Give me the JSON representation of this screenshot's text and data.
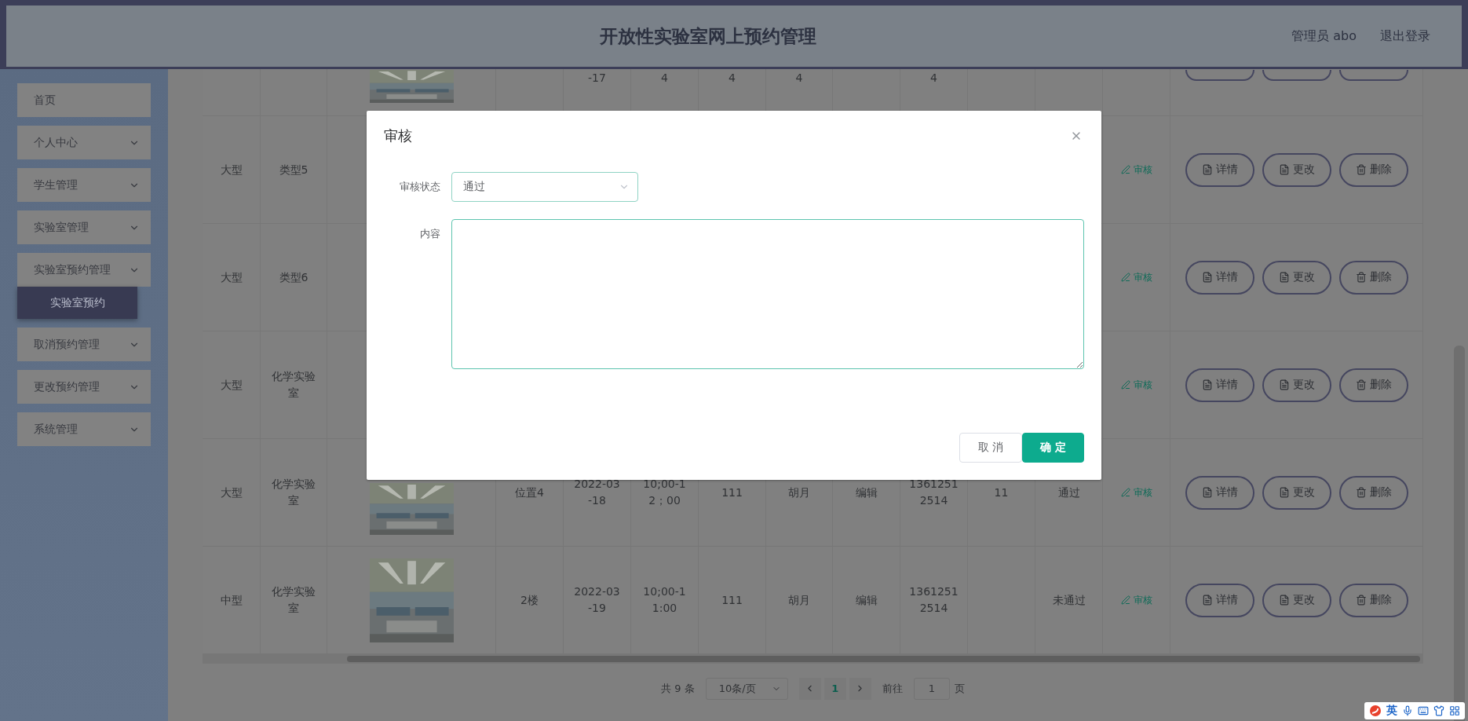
{
  "header": {
    "title": "开放性实验室网上预约管理",
    "user": "管理员 abo",
    "logout": "退出登录"
  },
  "sidebar": {
    "items": [
      {
        "label": "首页",
        "kind": "link"
      },
      {
        "label": "个人中心",
        "kind": "menu"
      },
      {
        "label": "学生管理",
        "kind": "menu"
      },
      {
        "label": "实验室管理",
        "kind": "menu"
      },
      {
        "label": "实验室预约管理",
        "kind": "menu",
        "expanded": true,
        "children": [
          {
            "label": "实验室预约"
          }
        ]
      },
      {
        "label": "取消预约管理",
        "kind": "menu"
      },
      {
        "label": "更改预约管理",
        "kind": "menu"
      },
      {
        "label": "系统管理",
        "kind": "menu"
      }
    ]
  },
  "table": {
    "rows": [
      {
        "kind": "cut",
        "picture": true,
        "middle": [
          {
            "kind": "blank"
          },
          {
            "kind": "text",
            "text": "-17"
          },
          {
            "kind": "text",
            "text": "4"
          },
          {
            "kind": "text",
            "text": "4"
          },
          {
            "kind": "text",
            "text": "4"
          },
          {
            "kind": "blank"
          },
          {
            "kind": "text",
            "text": "4"
          },
          {
            "kind": "blank"
          },
          {
            "kind": "blank"
          }
        ]
      },
      {
        "kind": "full",
        "left": [
          "大型",
          "类型5"
        ],
        "review": "审核",
        "actions": [
          "详情",
          "更改",
          "删除"
        ]
      },
      {
        "kind": "full",
        "left": [
          "大型",
          "类型6"
        ],
        "review": "审核",
        "actions": [
          "详情",
          "更改",
          "删除"
        ]
      },
      {
        "kind": "full",
        "left": [
          "大型",
          "化学实验室"
        ],
        "review": "审核",
        "actions": [
          "详情",
          "更改",
          "删除"
        ]
      },
      {
        "kind": "full",
        "left": [
          "大型",
          "化学实验室"
        ],
        "picture": true,
        "middle": [
          {
            "text": "位置4"
          },
          {
            "text": "2022-03\n-18"
          },
          {
            "text": "10;00-1\n2；00"
          },
          {
            "text": "111"
          },
          {
            "text": "胡月"
          },
          {
            "text": "编辑"
          },
          {
            "text": "1361251\n2514"
          },
          {
            "text": "11"
          },
          {
            "text": "通过"
          }
        ],
        "review": "审核",
        "actions": [
          "详情",
          "更改",
          "删除"
        ]
      },
      {
        "kind": "full",
        "left": [
          "中型",
          "化学实验室"
        ],
        "picture": true,
        "middle": [
          {
            "text": "2楼"
          },
          {
            "text": "2022-03\n-19"
          },
          {
            "text": "10;00-1\n1:00"
          },
          {
            "text": "111"
          },
          {
            "text": "胡月"
          },
          {
            "text": "编辑"
          },
          {
            "text": "1361251\n2514"
          },
          {
            "kind": "blank"
          },
          {
            "text": "未通过"
          }
        ],
        "review": "审核",
        "actions": [
          "详情",
          "更改",
          "删除"
        ]
      }
    ]
  },
  "pagination": {
    "total": "共 9 条",
    "page_size": "10条/页",
    "pages": [
      {
        "label": "1",
        "selected": true
      }
    ],
    "goto_label": "前往",
    "goto_value": "1",
    "goto_suffix": "页"
  },
  "dialog": {
    "title": "审核",
    "fields": [
      {
        "kind": "select",
        "label": "审核状态",
        "value": "通过"
      },
      {
        "kind": "textarea",
        "label": "内容"
      }
    ],
    "buttons": [
      {
        "kind": "default",
        "label": "取 消"
      },
      {
        "kind": "primary",
        "label": "确 定"
      }
    ]
  },
  "ime_bar": {
    "language": "英"
  }
}
